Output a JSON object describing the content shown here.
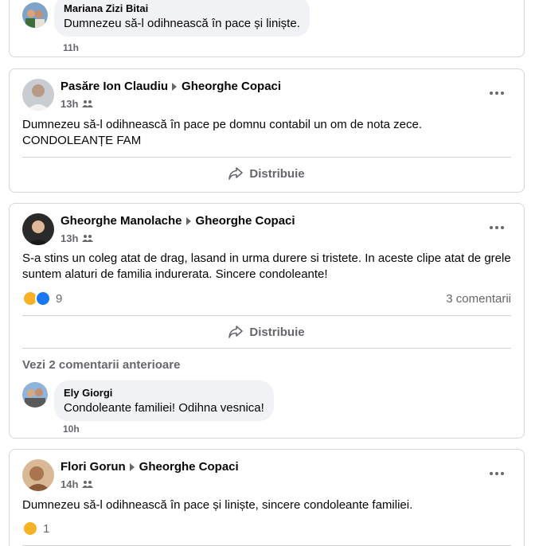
{
  "top_comment": {
    "author": "Mariana Zizi Bitai",
    "text": "Dumnezeu să-l odihnească în pace și liniște.",
    "time": "11h"
  },
  "posts": [
    {
      "author": "Pasăre Ion Claudiu",
      "target": "Gheorghe Copaci",
      "time": "13h",
      "text": "Dumnezeu să-l odihnească în pace pe domnu contabil un om de nota zece. CONDOLEANȚE FAM",
      "share_label": "Distribuie"
    },
    {
      "author": "Gheorghe Manolache",
      "target": "Gheorghe Copaci",
      "time": "13h",
      "text": "S-a stins un coleg atat de drag, lasand in urma durere si tristete. In aceste clipe atat de grele suntem alaturi de familia indurerata. Sincere condoleante!",
      "reaction_count": "9",
      "comments_count": "3 comentarii",
      "share_label": "Distribuie",
      "more_comments": "Vezi 2 comentarii anterioare",
      "comment": {
        "author": "Ely Giorgi",
        "text": "Condoleante familiei! Odihna vesnica!",
        "time": "10h"
      }
    },
    {
      "author": "Flori Gorun",
      "target": "Gheorghe Copaci",
      "time": "14h",
      "text": "Dumnezeu să-l odihnească în pace și liniște, sincere condoleante familiei.",
      "reaction_count": "1"
    }
  ],
  "colors": {
    "sad_reaction": "#f7b125",
    "like_reaction": "#1877f2",
    "secondary_text": "#65676b",
    "bubble_bg": "#f0f2f5"
  },
  "icons": [
    "group-icon",
    "share-arrow-icon",
    "more-dots-icon",
    "sad-reaction-icon",
    "like-reaction-icon"
  ]
}
